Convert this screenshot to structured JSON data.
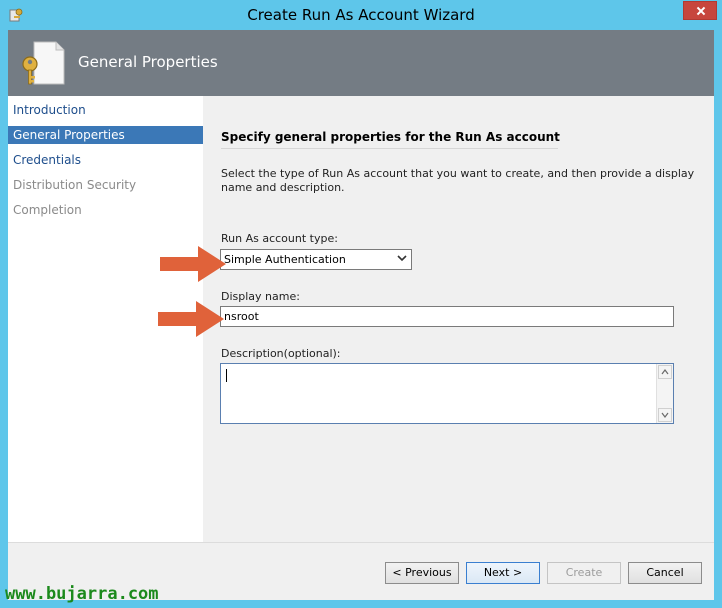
{
  "window": {
    "title": "Create Run As Account Wizard"
  },
  "header": {
    "title": "General Properties"
  },
  "nav": {
    "items": [
      {
        "label": "Introduction",
        "state": "normal"
      },
      {
        "label": "General Properties",
        "state": "selected"
      },
      {
        "label": "Credentials",
        "state": "normal"
      },
      {
        "label": "Distribution Security",
        "state": "disabled"
      },
      {
        "label": "Completion",
        "state": "disabled"
      }
    ]
  },
  "content": {
    "section_title": "Specify general properties for the Run As account",
    "intro": "Select the type of Run As account that you want to create, and then provide a display name and description.",
    "account_type_label": "Run As account type:",
    "account_type_value": "Simple Authentication",
    "display_name_label": "Display name:",
    "display_name_value": "nsroot",
    "description_label": "Description(optional):",
    "description_value": ""
  },
  "buttons": {
    "previous": "< Previous",
    "next": "Next >",
    "create": "Create",
    "cancel": "Cancel"
  },
  "watermark": "www.bujarra.com",
  "colors": {
    "title_bar": "#5ec6ea",
    "header_bg": "#747c84",
    "nav_selected": "#3b78b7",
    "arrow": "#e0623a",
    "watermark": "#1c8a1c"
  }
}
